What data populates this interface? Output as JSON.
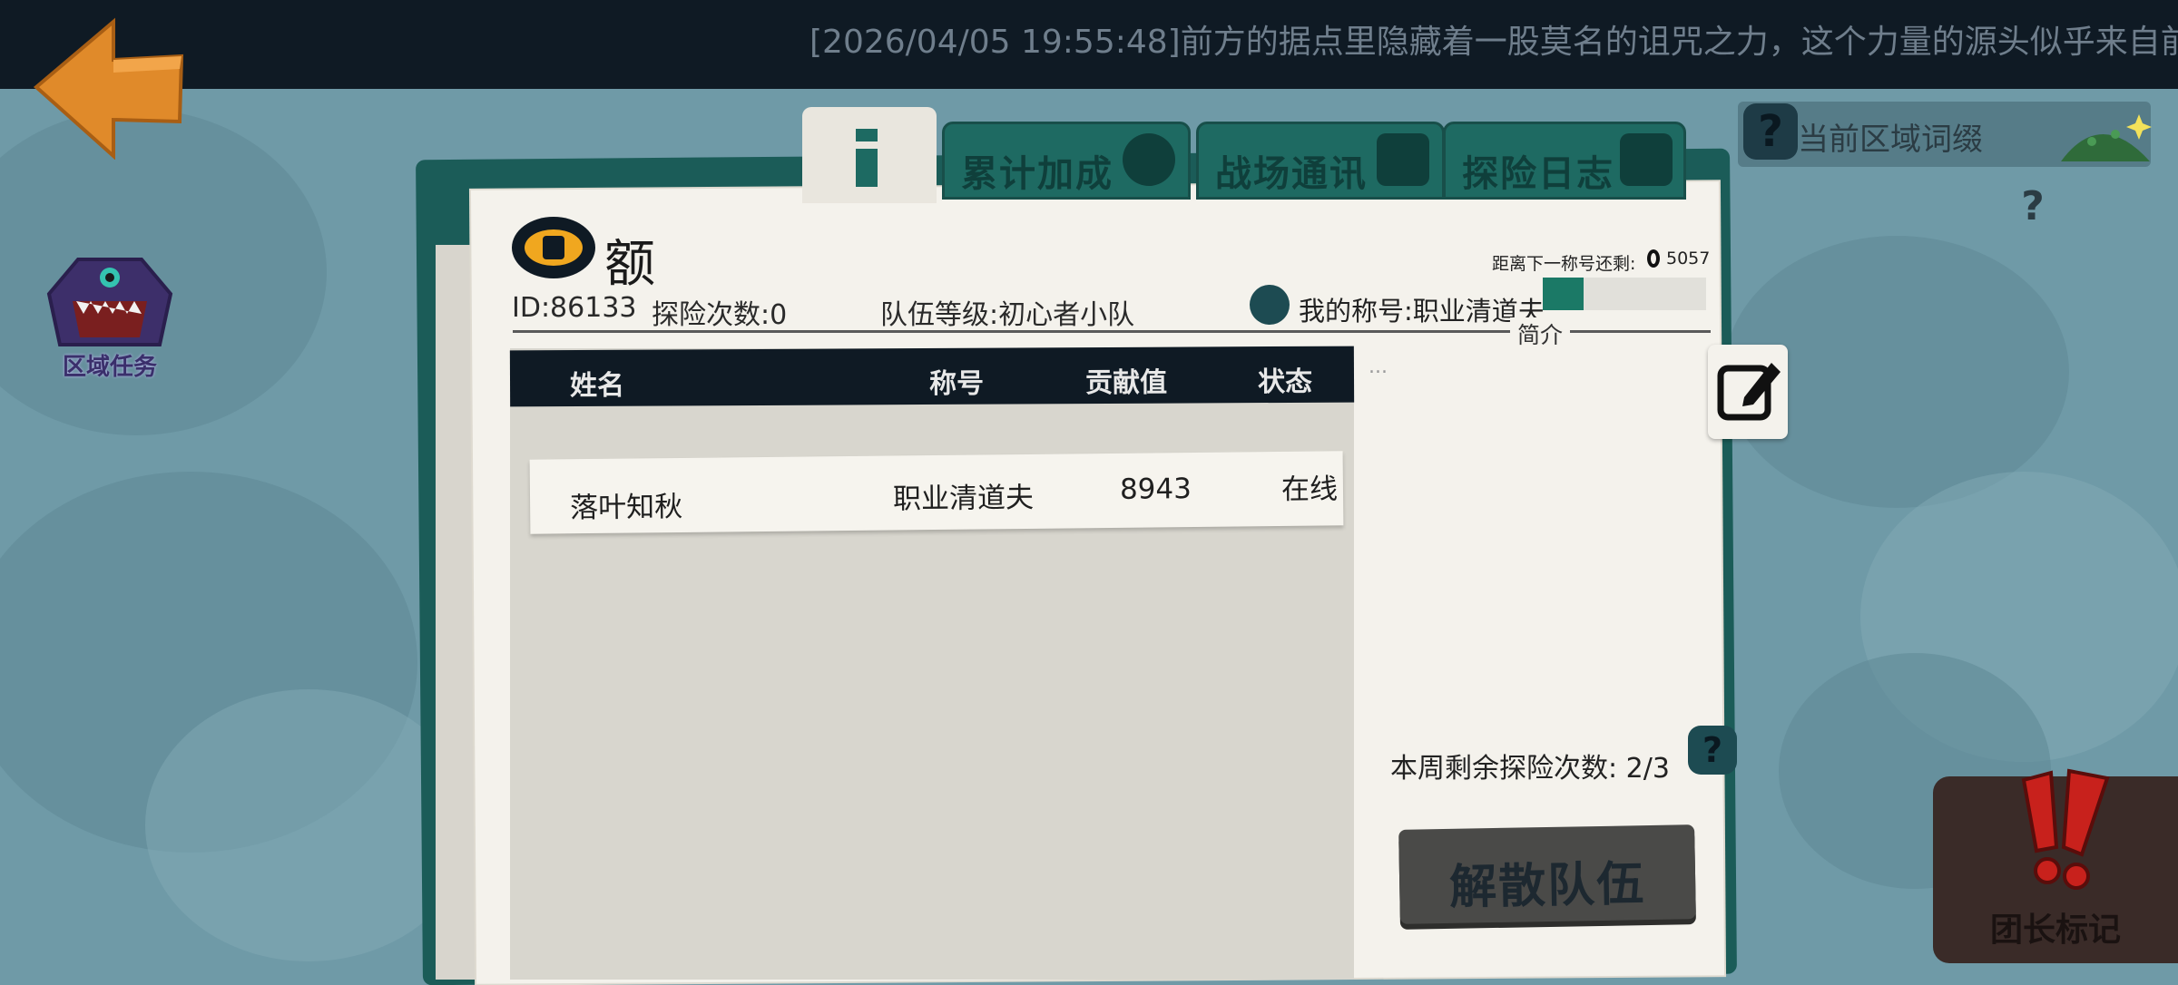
{
  "ticker": {
    "text": "[2026/04/05 19:55:48]前方的据点里隐藏着一股莫名的诅咒之力，这个力量的源头似乎来自前方"
  },
  "nav": {
    "back_icon": "back-arrow-icon"
  },
  "region_quest": {
    "label": "区域任务",
    "icon": "monster-mouth-icon"
  },
  "region_affix": {
    "label": "当前区域词缀",
    "help_glyph": "?",
    "sub_help_glyph": "?"
  },
  "tabs": {
    "info_icon": "info-icon",
    "items": [
      {
        "label": "累计加成",
        "icon": "skull-icon"
      },
      {
        "label": "战场通讯",
        "icon": "chat-icon"
      },
      {
        "label": "探险日志",
        "icon": "edit-icon"
      }
    ]
  },
  "team": {
    "name": "额",
    "id_text": "ID:86133",
    "expeditions_text": "探险次数:0",
    "level_text": "队伍等级:初心者小队",
    "next_title_label": "距离下一称号还剩:",
    "next_title_value": "5057",
    "my_title_text": "我的称号:职业清道夫",
    "title_progress": 0.25,
    "intro_label": "简介",
    "intro_text": "..."
  },
  "table": {
    "headers": {
      "name": "姓名",
      "title": "称号",
      "contribution": "贡献值",
      "status": "状态"
    },
    "rows": [
      {
        "name": "落叶知秋",
        "title": "职业清道夫",
        "contribution": "8943",
        "status": "在线"
      }
    ]
  },
  "actions": {
    "remaining_label": "本周剩余探险次数:",
    "remaining_value": "2/3",
    "remaining_help": "?",
    "disband_label": "解散队伍",
    "leader_mark_label": "团长标记"
  },
  "colors": {
    "background": "#6f9aa7",
    "ticker": "#0f1a24",
    "book": "#1b5c58",
    "paper": "#f4f2ec",
    "accent": "#1b7966",
    "back_arrow": "#e08a2a"
  }
}
